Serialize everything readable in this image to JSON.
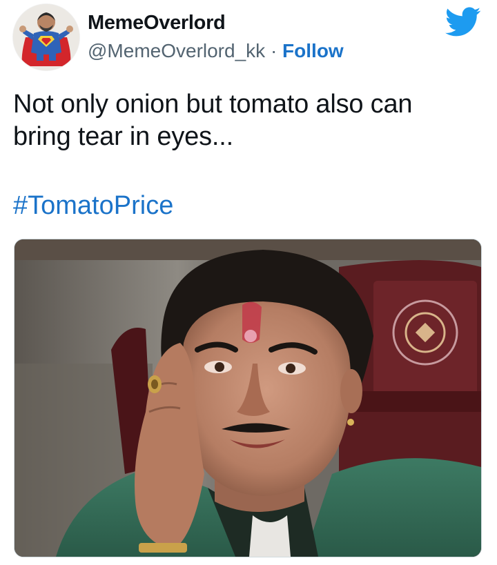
{
  "tweet": {
    "author_name": "MemeOverlord",
    "author_handle": "@MemeOverlord_kk",
    "separator": "·",
    "follow_label": "Follow",
    "text_lines": [
      "Not only onion but tomato also can",
      "bring tear in eyes..."
    ],
    "hashtag": "#TomatoPrice",
    "platform_icon": "twitter-bird-icon",
    "media_description_icon": "photo"
  },
  "colors": {
    "link_blue": "#1b73c9",
    "twitter_blue": "#1d9bf0",
    "text_primary": "#0f1419",
    "text_secondary": "#536471"
  }
}
